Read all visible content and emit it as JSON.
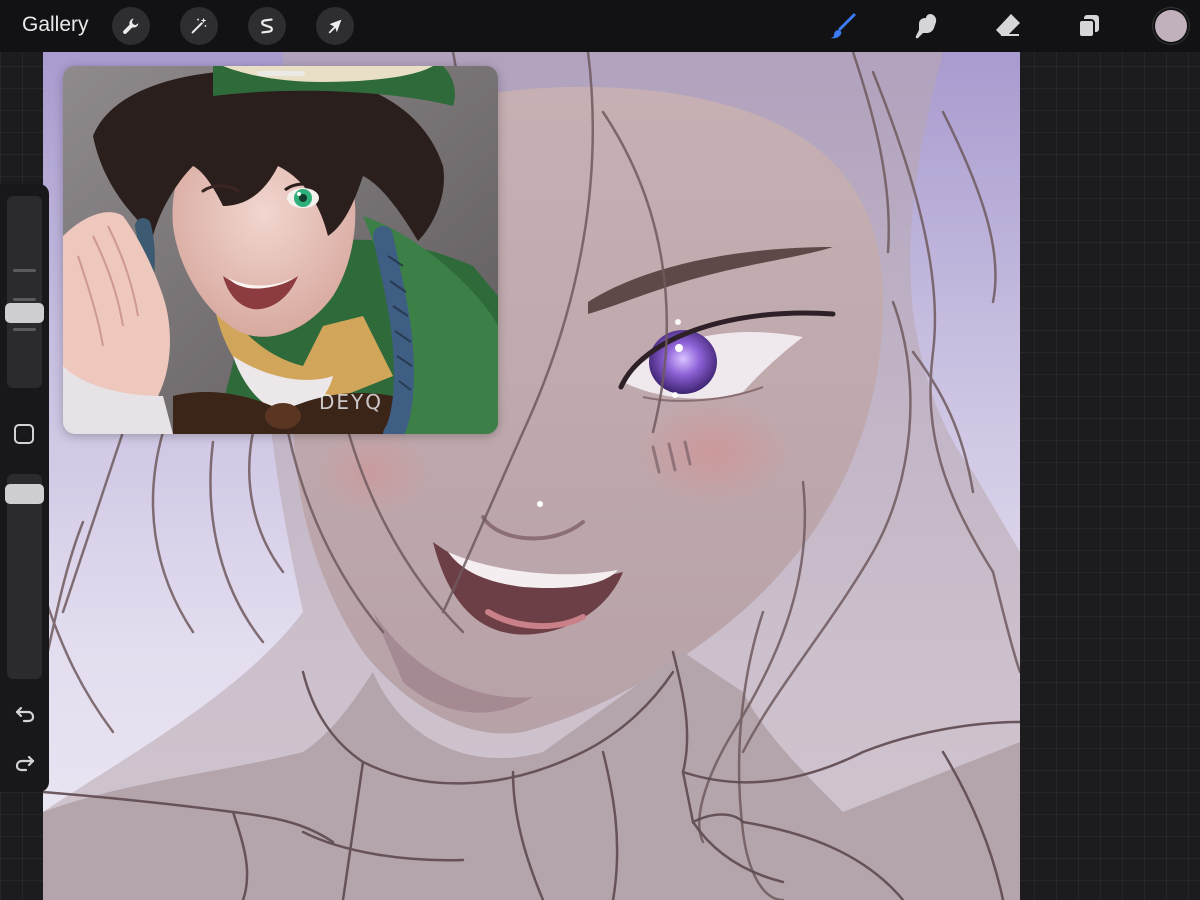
{
  "topbar": {
    "gallery_label": "Gallery",
    "left_tools": [
      {
        "icon": "wrench-icon",
        "name": "actions"
      },
      {
        "icon": "magic-wand-icon",
        "name": "adjustments"
      },
      {
        "icon": "selection-icon",
        "name": "selection"
      },
      {
        "icon": "transform-arrow-icon",
        "name": "transform"
      }
    ],
    "right_tools": [
      {
        "icon": "brush-icon",
        "name": "paint",
        "active": true
      },
      {
        "icon": "smudge-icon",
        "name": "smudge"
      },
      {
        "icon": "eraser-icon",
        "name": "erase"
      },
      {
        "icon": "layers-icon",
        "name": "layers"
      }
    ],
    "current_color": "#c1b1bc",
    "active_tool_color": "#3b7cf6"
  },
  "reference": {
    "signature": "DEYQ"
  },
  "sidebar": {
    "brush_size_level": 0.5,
    "opacity_level": 0.9,
    "modify_button": "square-icon",
    "undo": "undo-icon",
    "redo": "redo-icon"
  }
}
